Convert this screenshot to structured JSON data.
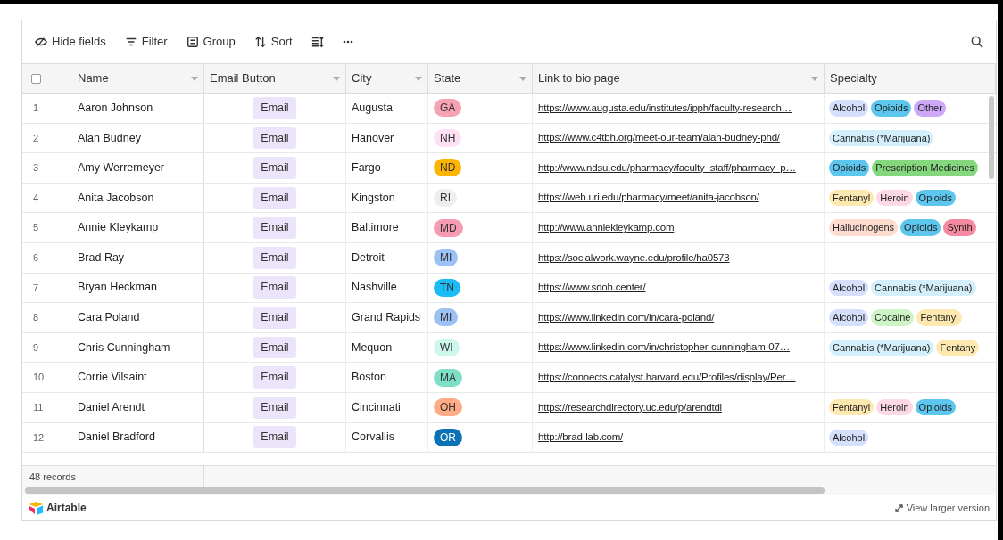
{
  "toolbar": {
    "items": [
      {
        "label": "Hide fields",
        "kind": "hide"
      },
      {
        "label": "Filter",
        "kind": "filter"
      },
      {
        "label": "Group",
        "kind": "group"
      },
      {
        "label": "Sort",
        "kind": "sort"
      },
      {
        "kind": "rowheight"
      },
      {
        "kind": "more"
      }
    ]
  },
  "table": {
    "select_all": {
      "checked": false
    },
    "columns": [
      "Name",
      "Email Button",
      "City",
      "State",
      "Link to bio page",
      "Specialty"
    ],
    "rows": [
      {
        "number": "1",
        "name": "Aaron Johnson",
        "email": "Email",
        "city": "Augusta",
        "state": {
          "label": "GA",
          "color": "#f7a1b5"
        },
        "link": "https://www.augusta.edu/institutes/ipph/faculty-research…",
        "specialty": [
          {
            "label": "Alcohol",
            "color": "#d5dffc"
          },
          {
            "label": "Opioids",
            "color": "#5cc6ee"
          },
          {
            "label": "Other",
            "color": "#cda8f7"
          }
        ]
      },
      {
        "number": "2",
        "name": "Alan Budney",
        "email": "Email",
        "city": "Hanover",
        "state": {
          "label": "NH",
          "color": "#fde0f3"
        },
        "link": "https://www.c4tbh.org/meet-our-team/alan-budney-phd/",
        "specialty": [
          {
            "label": "Cannabis (*Marijuana)",
            "color": "#d4effc"
          }
        ]
      },
      {
        "number": "3",
        "name": "Amy Werremeyer",
        "email": "Email",
        "city": "Fargo",
        "state": {
          "label": "ND",
          "color": "#fcb400"
        },
        "link": "http://www.ndsu.edu/pharmacy/faculty_staff/pharmacy_p…",
        "specialty": [
          {
            "label": "Opioids",
            "color": "#5cc6ee"
          },
          {
            "label": "Prescription Medicines",
            "color": "#85d77e"
          }
        ]
      },
      {
        "number": "4",
        "name": "Anita Jacobson",
        "email": "Email",
        "city": "Kingston",
        "state": {
          "label": "RI",
          "color": "#eeeeee"
        },
        "link": "https://web.uri.edu/pharmacy/meet/anita-jacobson/",
        "specialty": [
          {
            "label": "Fentanyl",
            "color": "#fde9b0"
          },
          {
            "label": "Heroin",
            "color": "#fdd9e3"
          },
          {
            "label": "Opioids",
            "color": "#5cc6ee"
          }
        ]
      },
      {
        "number": "5",
        "name": "Annie Kleykamp",
        "email": "Email",
        "city": "Baltimore",
        "state": {
          "label": "MD",
          "color": "#f59bb3"
        },
        "link": "http://www.anniekleykamp.com",
        "specialty": [
          {
            "label": "Hallucinogens",
            "color": "#fedbcf"
          },
          {
            "label": "Opioids",
            "color": "#5cc6ee"
          },
          {
            "label": "Synth",
            "color": "#f5899f"
          }
        ]
      },
      {
        "number": "6",
        "name": "Brad Ray",
        "email": "Email",
        "city": "Detroit",
        "state": {
          "label": "MI",
          "color": "#9cc1f5"
        },
        "link": "https://socialwork.wayne.edu/profile/ha0573",
        "specialty": []
      },
      {
        "number": "7",
        "name": "Bryan Heckman",
        "email": "Email",
        "city": "Nashville",
        "state": {
          "label": "TN",
          "color": "#1bbcf5"
        },
        "link": "https://www.sdoh.center/",
        "specialty": [
          {
            "label": "Alcohol",
            "color": "#d5dffc"
          },
          {
            "label": "Cannabis (*Marijuana)",
            "color": "#d4effc"
          }
        ]
      },
      {
        "number": "8",
        "name": "Cara Poland",
        "email": "Email",
        "city": "Grand Rapids",
        "state": {
          "label": "MI",
          "color": "#9cc1f5"
        },
        "link": "https://www.linkedin.com/in/cara-poland/",
        "specialty": [
          {
            "label": "Alcohol",
            "color": "#d5dffc"
          },
          {
            "label": "Cocaine",
            "color": "#cdf3c6"
          },
          {
            "label": "Fentanyl",
            "color": "#fde9b0"
          }
        ]
      },
      {
        "number": "9",
        "name": "Chris Cunningham",
        "email": "Email",
        "city": "Mequon",
        "state": {
          "label": "WI",
          "color": "#cdf6ec"
        },
        "link": "https://www.linkedin.com/in/christopher-cunningham-07…",
        "specialty": [
          {
            "label": "Cannabis (*Marijuana)",
            "color": "#d4effc"
          },
          {
            "label": "Fentany",
            "color": "#fde9b0"
          }
        ]
      },
      {
        "number": "10",
        "name": "Corrie Vilsaint",
        "email": "Email",
        "city": "Boston",
        "state": {
          "label": "MA",
          "color": "#7ddfc6"
        },
        "link": "https://connects.catalyst.harvard.edu/Profiles/display/Per…",
        "specialty": []
      },
      {
        "number": "11",
        "name": "Daniel Arendt",
        "email": "Email",
        "city": "Cincinnati",
        "state": {
          "label": "OH",
          "color": "#ffab85"
        },
        "link": "https://researchdirectory.uc.edu/p/arendtdl",
        "specialty": [
          {
            "label": "Fentanyl",
            "color": "#fde9b0"
          },
          {
            "label": "Heroin",
            "color": "#fdd9e3"
          },
          {
            "label": "Opioids",
            "color": "#5cc6ee"
          }
        ]
      },
      {
        "number": "12",
        "name": "Daniel Bradford",
        "email": "Email",
        "city": "Corvallis",
        "state": {
          "label": "OR",
          "color": "#0b72b5"
        },
        "link": "http://brad-lab.com/",
        "specialty": [
          {
            "label": "Alcohol",
            "color": "#d5dffc"
          }
        ]
      }
    ]
  },
  "footer": {
    "record_count": "48 records"
  },
  "brand": {
    "name": "Airtable",
    "link": "View larger version"
  }
}
